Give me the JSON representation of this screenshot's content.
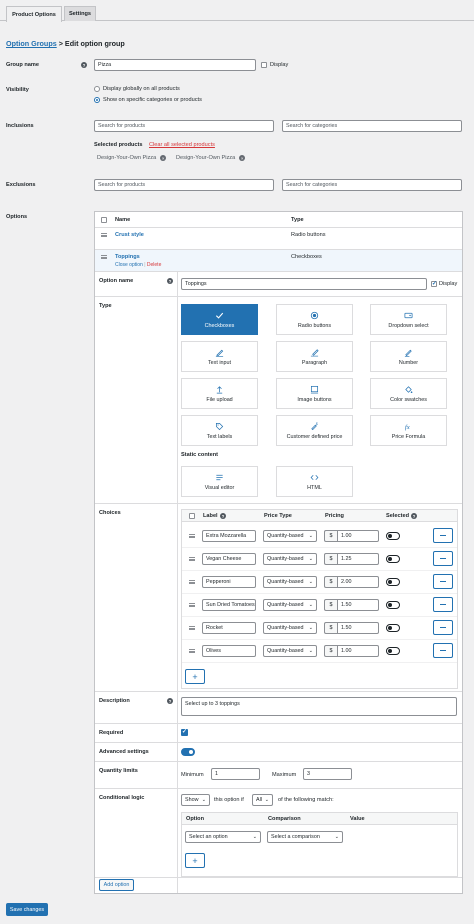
{
  "tabs": [
    {
      "label": "Product Options"
    },
    {
      "label": "Settings"
    }
  ],
  "breadcrumb": {
    "link": "Option Groups",
    "sep": " > ",
    "current": "Edit option group"
  },
  "group_name": {
    "label": "Group name",
    "value": "Pizza",
    "display_label": "Display"
  },
  "visibility": {
    "label": "Visibility",
    "options": [
      "Display globally on all products",
      "Show on specific categories or products"
    ],
    "selected": 1
  },
  "inclusions": {
    "label": "Inclusions",
    "products_placeholder": "Search for products",
    "categories_placeholder": "Search for categories",
    "selected_label": "Selected products",
    "clear_label": "Clear all selected products",
    "selected": [
      "Design-Your-Own Pizza",
      "Design-Your-Own Pizza"
    ]
  },
  "exclusions": {
    "label": "Exclusions",
    "products_placeholder": "Search for products",
    "categories_placeholder": "Search for categories"
  },
  "options": {
    "label": "Options",
    "col_name": "Name",
    "col_type": "Type",
    "rows": [
      {
        "name": "Crust style",
        "type": "Radio buttons"
      },
      {
        "name": "Toppings",
        "type": "Checkboxes",
        "close": "Close option",
        "sep": "|",
        "delete": "Delete"
      }
    ]
  },
  "editor": {
    "option_name_label": "Option name",
    "option_name_value": "Toppings",
    "display_label": "Display",
    "type_label": "Type",
    "types": [
      {
        "label": "Checkboxes",
        "icon": "check-icon",
        "selected": true
      },
      {
        "label": "Radio buttons",
        "icon": "radio-icon"
      },
      {
        "label": "Dropdown select",
        "icon": "dropdown-icon"
      },
      {
        "label": "Text input",
        "icon": "text-input-icon"
      },
      {
        "label": "Paragraph",
        "icon": "paragraph-icon"
      },
      {
        "label": "Number",
        "icon": "number-icon"
      },
      {
        "label": "File upload",
        "icon": "upload-icon"
      },
      {
        "label": "Image buttons",
        "icon": "image-icon"
      },
      {
        "label": "Color swatches",
        "icon": "color-swatch-icon"
      },
      {
        "label": "Text labels",
        "icon": "tag-icon"
      },
      {
        "label": "Customer defined price",
        "icon": "customer-price-icon"
      },
      {
        "label": "Price Formula",
        "icon": "formula-icon"
      }
    ],
    "static_label": "Static content",
    "static_types": [
      {
        "label": "Visual editor",
        "icon": "visual-editor-icon"
      },
      {
        "label": "HTML",
        "icon": "code-icon"
      }
    ],
    "choices_label": "Choices",
    "choices_headers": {
      "label": "Label",
      "price_type": "Price Type",
      "pricing": "Pricing",
      "selected": "Selected"
    },
    "currency": "$",
    "choices": [
      {
        "label": "Extra Mozzarella",
        "price_type": "Quantity-based",
        "price": "1.00"
      },
      {
        "label": "Vegan Cheese",
        "price_type": "Quantity-based",
        "price": "1.25"
      },
      {
        "label": "Pepperoni",
        "price_type": "Quantity-based",
        "price": "2.00"
      },
      {
        "label": "Sun Dried Tomatoes",
        "price_type": "Quantity-based",
        "price": "1.50"
      },
      {
        "label": "Rocket",
        "price_type": "Quantity-based",
        "price": "1.50"
      },
      {
        "label": "Olives",
        "price_type": "Quantity-based",
        "price": "1.00"
      }
    ],
    "add_choice": "+",
    "description_label": "Description",
    "description_value": "Select up to 3 toppings",
    "required_label": "Required",
    "advanced_label": "Advanced settings",
    "qty_label": "Quantity limits",
    "min_label": "Minimum",
    "min_value": "1",
    "max_label": "Maximum",
    "max_value": "3",
    "cond_label": "Conditional logic",
    "cond_show": "Show",
    "cond_mid": "this option if",
    "cond_all": "All",
    "cond_end": "of the following match:",
    "cond_headers": {
      "option": "Option",
      "comparison": "Comparison",
      "value": "Value"
    },
    "cond_option_placeholder": "Select an option",
    "cond_comparison_placeholder": "Select a comparison",
    "add_rule": "+"
  },
  "add_option": "Add option",
  "save": "Save changes",
  "accent_color": "#2271b1"
}
